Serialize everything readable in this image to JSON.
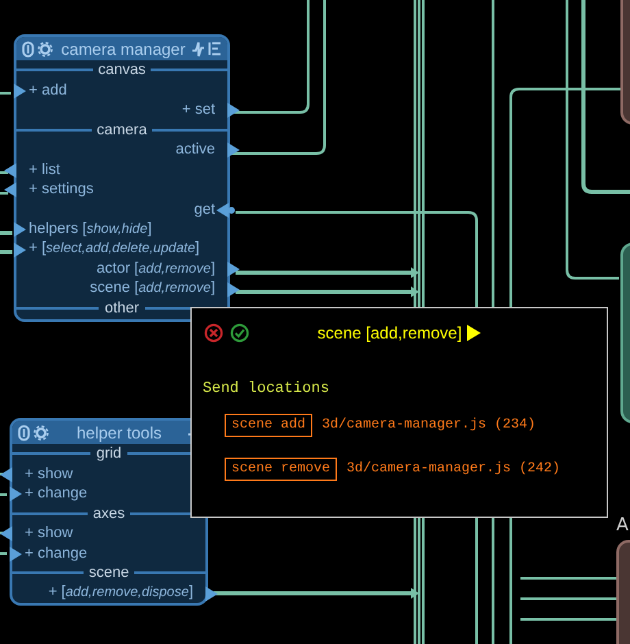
{
  "nodes": [
    {
      "title": "camera manager",
      "menu_icon": true,
      "sections": [
        {
          "label": "canvas",
          "ports": [
            {
              "label": "+ add",
              "right": false,
              "out": false
            },
            {
              "label": "+ set",
              "right": true,
              "out": true
            }
          ]
        },
        {
          "label": "camera",
          "ports": [
            {
              "label": "active",
              "right": true,
              "out": true
            },
            {
              "label": "+ list",
              "right": false,
              "out": true
            },
            {
              "label": "+ settings",
              "right": false,
              "out": true
            },
            {
              "label": "get",
              "right": true,
              "out": false
            },
            {
              "label": "helpers [*show,hide*]",
              "right": false,
              "out": false
            },
            {
              "label": "+ [*select,add,delete,update*]",
              "right": false,
              "out": false
            },
            {
              "label": "actor [*add,remove*]",
              "right": true,
              "out": true
            },
            {
              "label": "scene [*add,remove*]",
              "right": true,
              "out": true
            }
          ]
        },
        {
          "label": "other"
        }
      ]
    },
    {
      "title": "helper tools",
      "menu_icon": false,
      "sections": [
        {
          "label": "grid",
          "ports": [
            {
              "label": "+ show",
              "right": false,
              "out": true
            },
            {
              "label": "+ change",
              "right": false,
              "out": false
            }
          ]
        },
        {
          "label": "axes",
          "ports": [
            {
              "label": "+ show",
              "right": false,
              "out": true
            },
            {
              "label": "+ change",
              "right": false,
              "out": false
            }
          ]
        },
        {
          "label": "scene",
          "ports": [
            {
              "label": "+ [*add,remove,dispose*]",
              "right": true,
              "out": true
            }
          ]
        }
      ]
    }
  ],
  "partial_node": {
    "title": "A"
  },
  "popup": {
    "title": "scene [add,remove]",
    "heading": "Send locations",
    "locations": [
      {
        "label": "scene add",
        "file": "3d/camera-manager.js (234)"
      },
      {
        "label": "scene remove",
        "file": "3d/camera-manager.js (242)"
      }
    ]
  }
}
